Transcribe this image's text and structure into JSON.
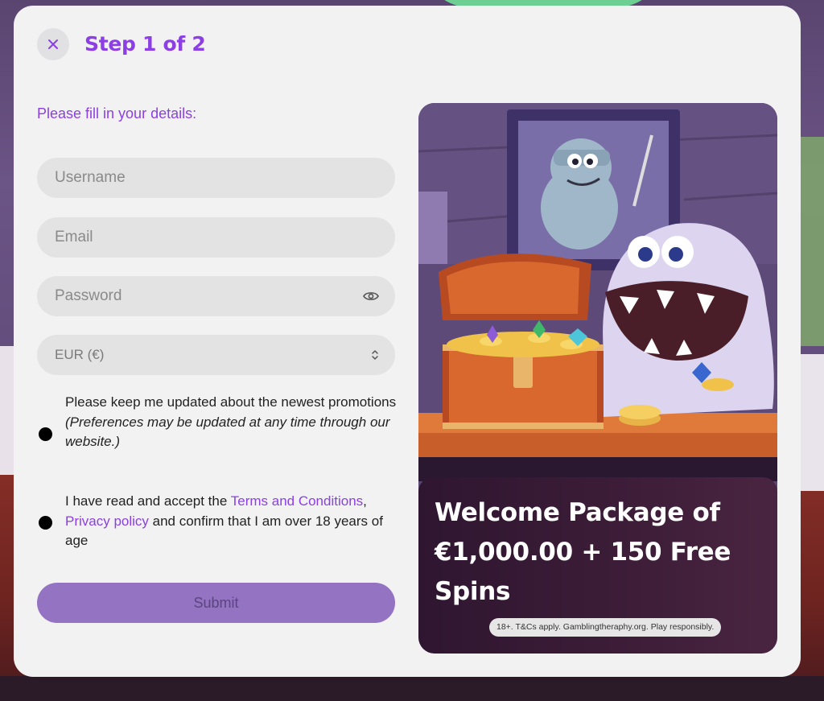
{
  "header": {
    "step_title": "Step 1 of 2"
  },
  "form": {
    "intro": "Please fill in your details:",
    "username_placeholder": "Username",
    "email_placeholder": "Email",
    "password_placeholder": "Password",
    "currency_selected": "EUR (€)",
    "checkbox_promotions": {
      "text": "Please keep me updated about the newest promotions",
      "note": "(Preferences may be updated at any time through our website.)"
    },
    "checkbox_terms": {
      "prefix": "I have read and accept the ",
      "terms_link": "Terms and Conditions",
      "comma": ",",
      "privacy_link": "Privacy policy",
      "suffix": " and confirm that I am over 18 years of age"
    },
    "submit_label": "Submit"
  },
  "promo": {
    "headline": "Welcome Package of €1,000.00 + 150 Free Spins",
    "disclaimer": "18+. T&Cs apply. Gamblingtheraphy.org. Play responsibly."
  },
  "icons": {
    "close": "close-icon",
    "password_toggle": "eye-icon",
    "currency_select": "chevron-updown-icon"
  },
  "colors": {
    "accent": "#8b3fe4",
    "submit_bg": "#9373c2",
    "modal_bg": "#f2f2f2",
    "field_bg": "#e3e3e3"
  }
}
